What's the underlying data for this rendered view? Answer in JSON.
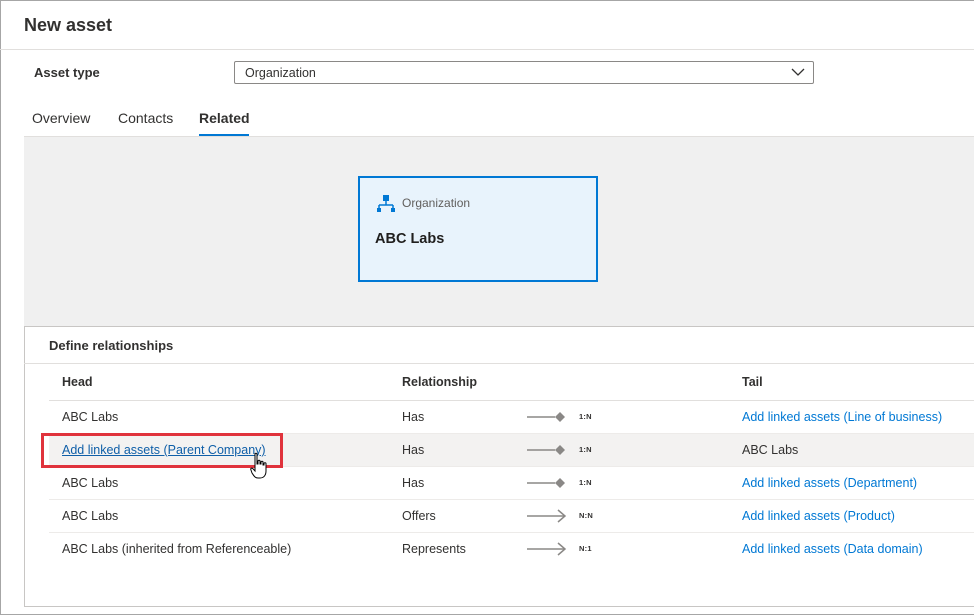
{
  "window": {
    "title": "New asset"
  },
  "form": {
    "asset_type_label": "Asset type",
    "asset_type_value": "Organization"
  },
  "tabs": [
    {
      "label": "Overview",
      "active": false
    },
    {
      "label": "Contacts",
      "active": false
    },
    {
      "label": "Related",
      "active": true
    }
  ],
  "node": {
    "type": "Organization",
    "name": "ABC Labs",
    "icon": "organization-icon"
  },
  "relationships": {
    "title": "Define relationships",
    "columns": {
      "head": "Head",
      "relationship": "Relationship",
      "tail": "Tail"
    },
    "rows": [
      {
        "head": "ABC Labs",
        "relationship": "Has",
        "cardinality": "1:N",
        "tail": "Add linked assets (Line of business)",
        "head_is_link": false,
        "tail_is_link": true,
        "connector": "diamond"
      },
      {
        "head": "Add linked assets (Parent Company)",
        "relationship": "Has",
        "cardinality": "1:N",
        "tail": "ABC Labs",
        "head_is_link": true,
        "tail_is_link": false,
        "connector": "diamond"
      },
      {
        "head": "ABC Labs",
        "relationship": "Has",
        "cardinality": "1:N",
        "tail": "Add linked assets (Department)",
        "head_is_link": false,
        "tail_is_link": true,
        "connector": "diamond"
      },
      {
        "head": "ABC Labs",
        "relationship": "Offers",
        "cardinality": "N:N",
        "tail": "Add linked assets (Product)",
        "head_is_link": false,
        "tail_is_link": true,
        "connector": "arrow"
      },
      {
        "head": "ABC Labs (inherited from Referenceable)",
        "relationship": "Represents",
        "cardinality": "N:1",
        "tail": "Add linked assets (Data domain)",
        "head_is_link": false,
        "tail_is_link": true,
        "connector": "arrow"
      }
    ]
  },
  "colors": {
    "accent": "#0078d4",
    "highlight_box": "#e0333c",
    "canvas_bg": "#f0f0f0",
    "node_bg": "#e8f3fc"
  }
}
